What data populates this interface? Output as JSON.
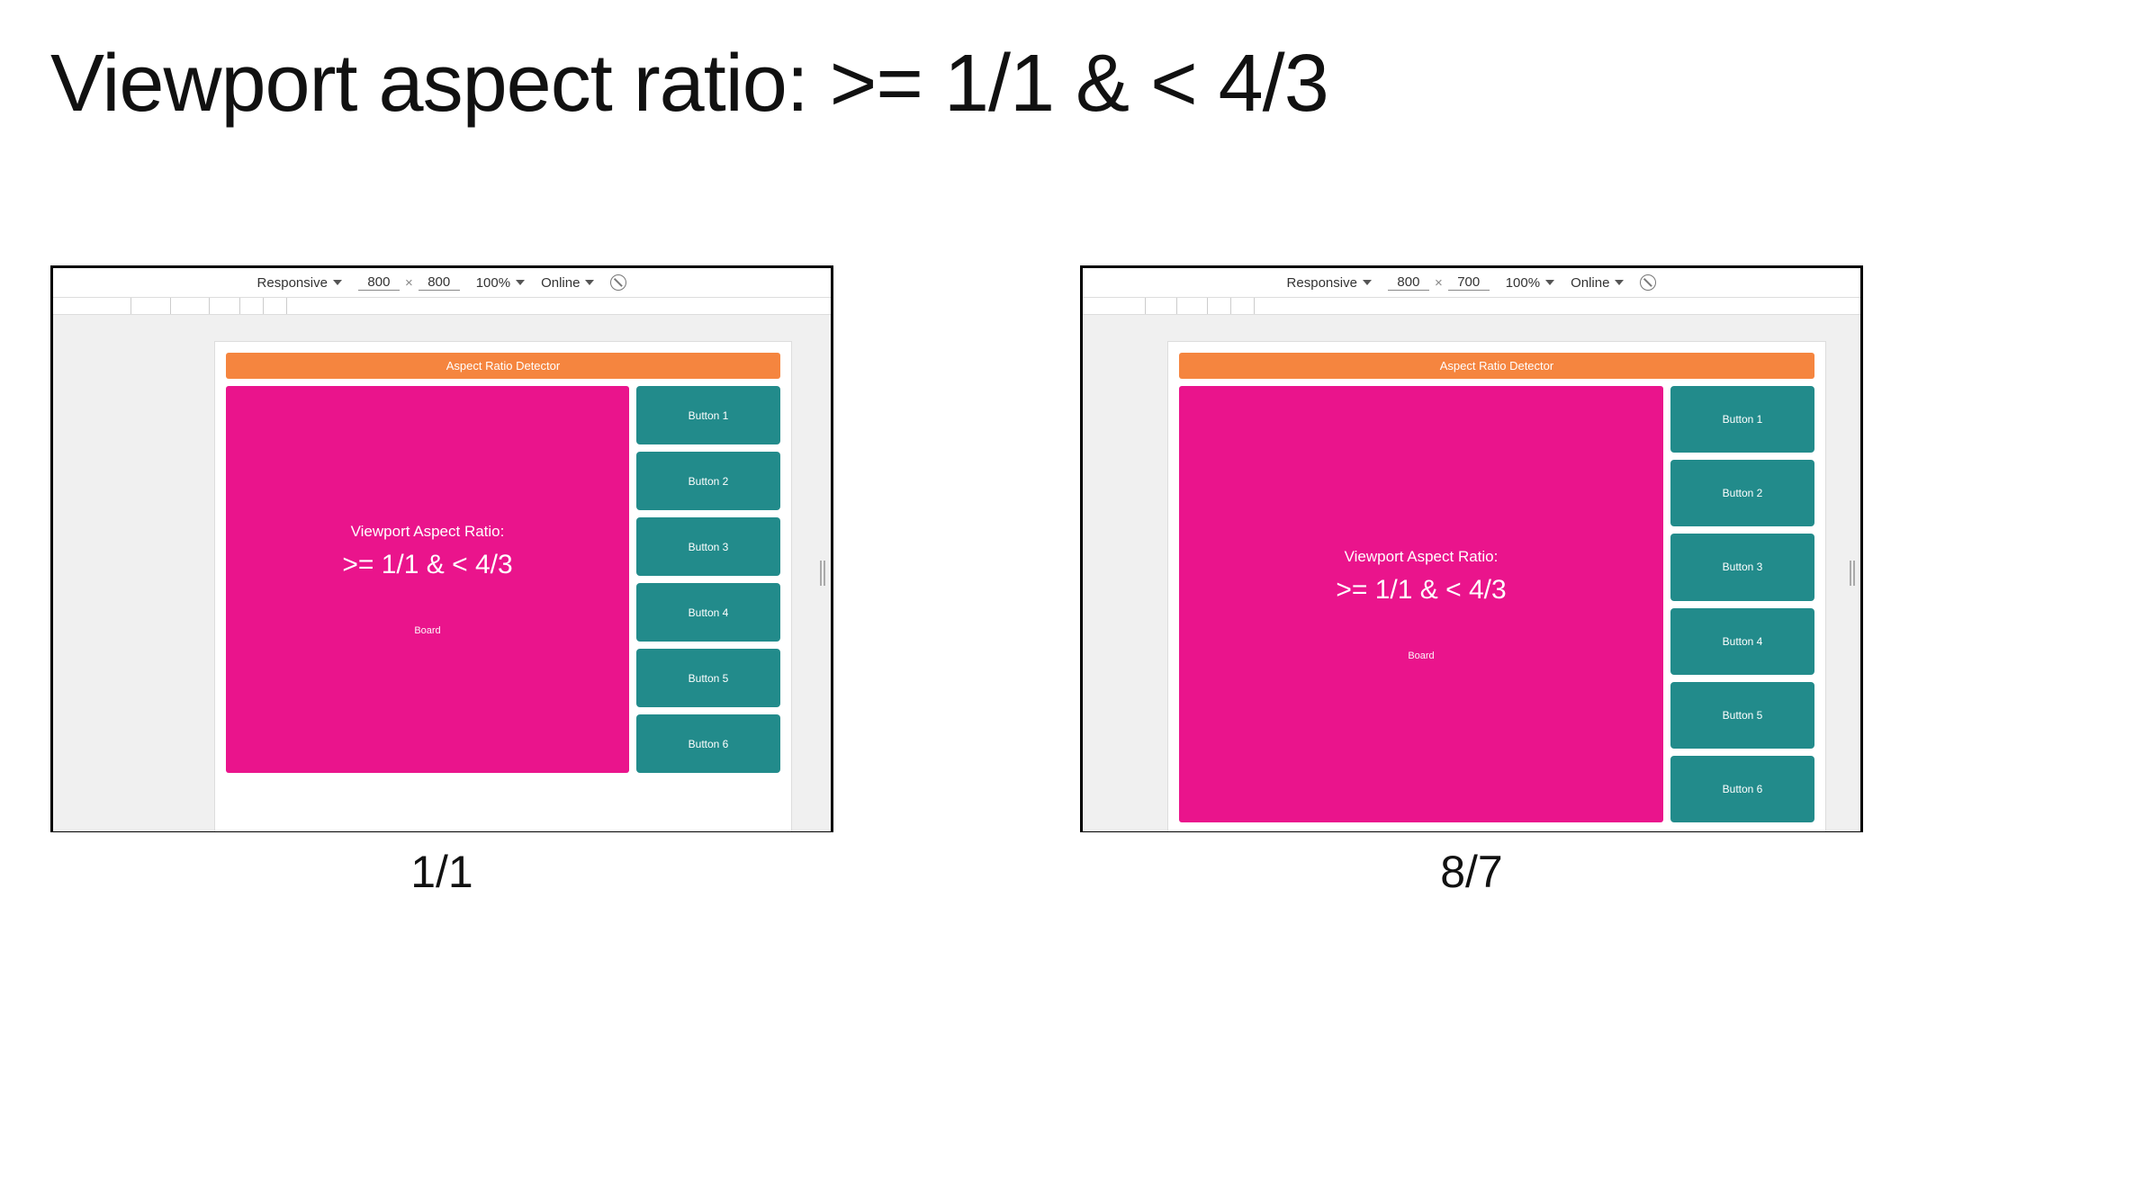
{
  "title": "Viewport aspect ratio: >= 1/1 & < 4/3",
  "left": {
    "caption": "1/1",
    "devtools": {
      "device": "Responsive",
      "width": "800",
      "height": "800",
      "zoom": "100%",
      "network": "Online"
    },
    "app": {
      "header": "Aspect Ratio Detector",
      "board": {
        "label": "Viewport Aspect Ratio:",
        "value": ">= 1/1 & < 4/3",
        "name": "Board"
      },
      "buttons": [
        "Button 1",
        "Button 2",
        "Button 3",
        "Button 4",
        "Button 5",
        "Button 6"
      ]
    }
  },
  "right": {
    "caption": "8/7",
    "devtools": {
      "device": "Responsive",
      "width": "800",
      "height": "700",
      "zoom": "100%",
      "network": "Online"
    },
    "app": {
      "header": "Aspect Ratio Detector",
      "board": {
        "label": "Viewport Aspect Ratio:",
        "value": ">= 1/1 & < 4/3",
        "name": "Board"
      },
      "buttons": [
        "Button 1",
        "Button 2",
        "Button 3",
        "Button 4",
        "Button 5",
        "Button 6"
      ]
    }
  }
}
